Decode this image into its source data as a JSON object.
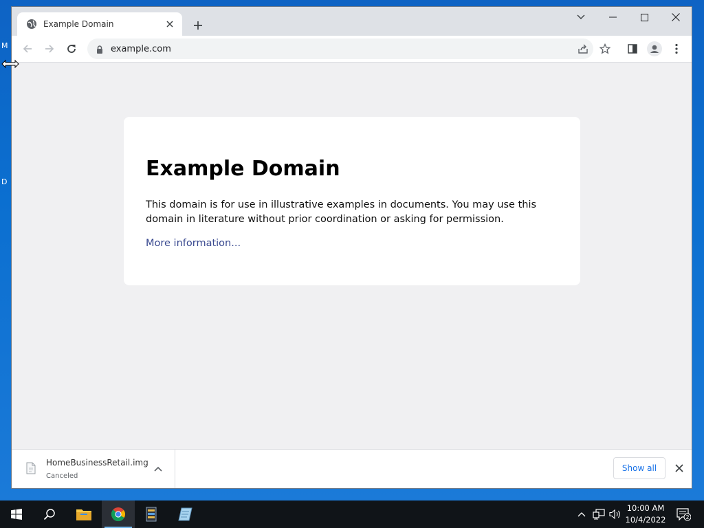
{
  "desktop": {
    "peek_labels": [
      "M",
      "D"
    ]
  },
  "browser": {
    "tab": {
      "title": "Example Domain",
      "favicon": "globe-icon"
    },
    "window_buttons": [
      "tab-search-icon",
      "minimize-icon",
      "maximize-icon",
      "close-icon"
    ],
    "toolbar": {
      "url": "example.com",
      "left_icons": [
        "back-icon",
        "forward-icon",
        "reload-icon"
      ],
      "right_icons": [
        "share-icon",
        "star-icon",
        "side-panel-icon",
        "profile-icon",
        "menu-icon"
      ]
    }
  },
  "page": {
    "heading": "Example Domain",
    "description": "This domain is for use in illustrative examples in documents. You may use this domain in literature without prior coordination or asking for permission.",
    "link": "More information..."
  },
  "download_bar": {
    "filename": "HomeBusinessRetail.img",
    "status": "Canceled",
    "show_all_label": "Show all"
  },
  "taskbar": {
    "apps": [
      "start-icon",
      "search-icon",
      "file-explorer-icon",
      "chrome-icon",
      "app-icon",
      "notepad-icon"
    ],
    "time": "10:00 AM",
    "date": "10/4/2022",
    "notification_count": "2"
  }
}
